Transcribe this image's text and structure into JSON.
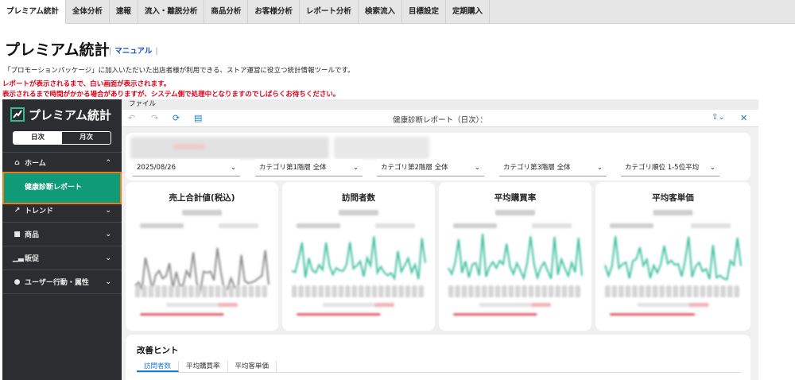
{
  "topnav": {
    "tabs": [
      "プレミアム統計",
      "全体分析",
      "速報",
      "流入・離脱分析",
      "商品分析",
      "お客様分析",
      "レポート分析",
      "検索流入",
      "目標設定",
      "定期購入"
    ]
  },
  "header": {
    "title": "プレミアム統計",
    "manual_label": "マニュアル",
    "description": "「プロモーションパッケージ」に加入いただいた出店者様が利用できる、ストア運営に役立つ統計情報ツールです。",
    "warning1": "レポートが表示されるまで、白い画面が表示されます。",
    "warning2": "表示されるまで時間がかかる場合がありますが、システム側で処理中となりますのでしばらくお待ちください。"
  },
  "sidebar": {
    "logo": "プレミアム統計",
    "toggle_daily": "日次",
    "toggle_monthly": "月次",
    "home": "ホーム",
    "health_report": "健康診断レポート",
    "trend": "トレンド",
    "product": "商品",
    "promotion": "販促",
    "user_attr": "ユーザー行動・属性"
  },
  "report": {
    "file_menu": "ファイル",
    "title": "健康診断レポート（日次）：",
    "filters": [
      {
        "value": "2025/08/26"
      },
      {
        "value": "カテゴリ第1階層 全体"
      },
      {
        "value": "カテゴリ第2階層 全体"
      },
      {
        "value": "カテゴリ第3階層 全体"
      },
      {
        "value": "カテゴリ順位 1-5位平均"
      }
    ],
    "kpis": [
      {
        "title": "売上合計値(税込)"
      },
      {
        "title": "訪問者数"
      },
      {
        "title": "平均購買率"
      },
      {
        "title": "平均客単価"
      }
    ],
    "hint_title": "改善ヒント",
    "hint_tabs": [
      "訪問者数",
      "平均購買率",
      "平均客単価"
    ]
  },
  "colors": {
    "accent_teal": "#0f9a78",
    "highlight_orange": "#f07a1c",
    "warning_red": "#e0001a",
    "link_blue": "#1a4fb5",
    "sidebar_bg": "#2b2d30"
  }
}
